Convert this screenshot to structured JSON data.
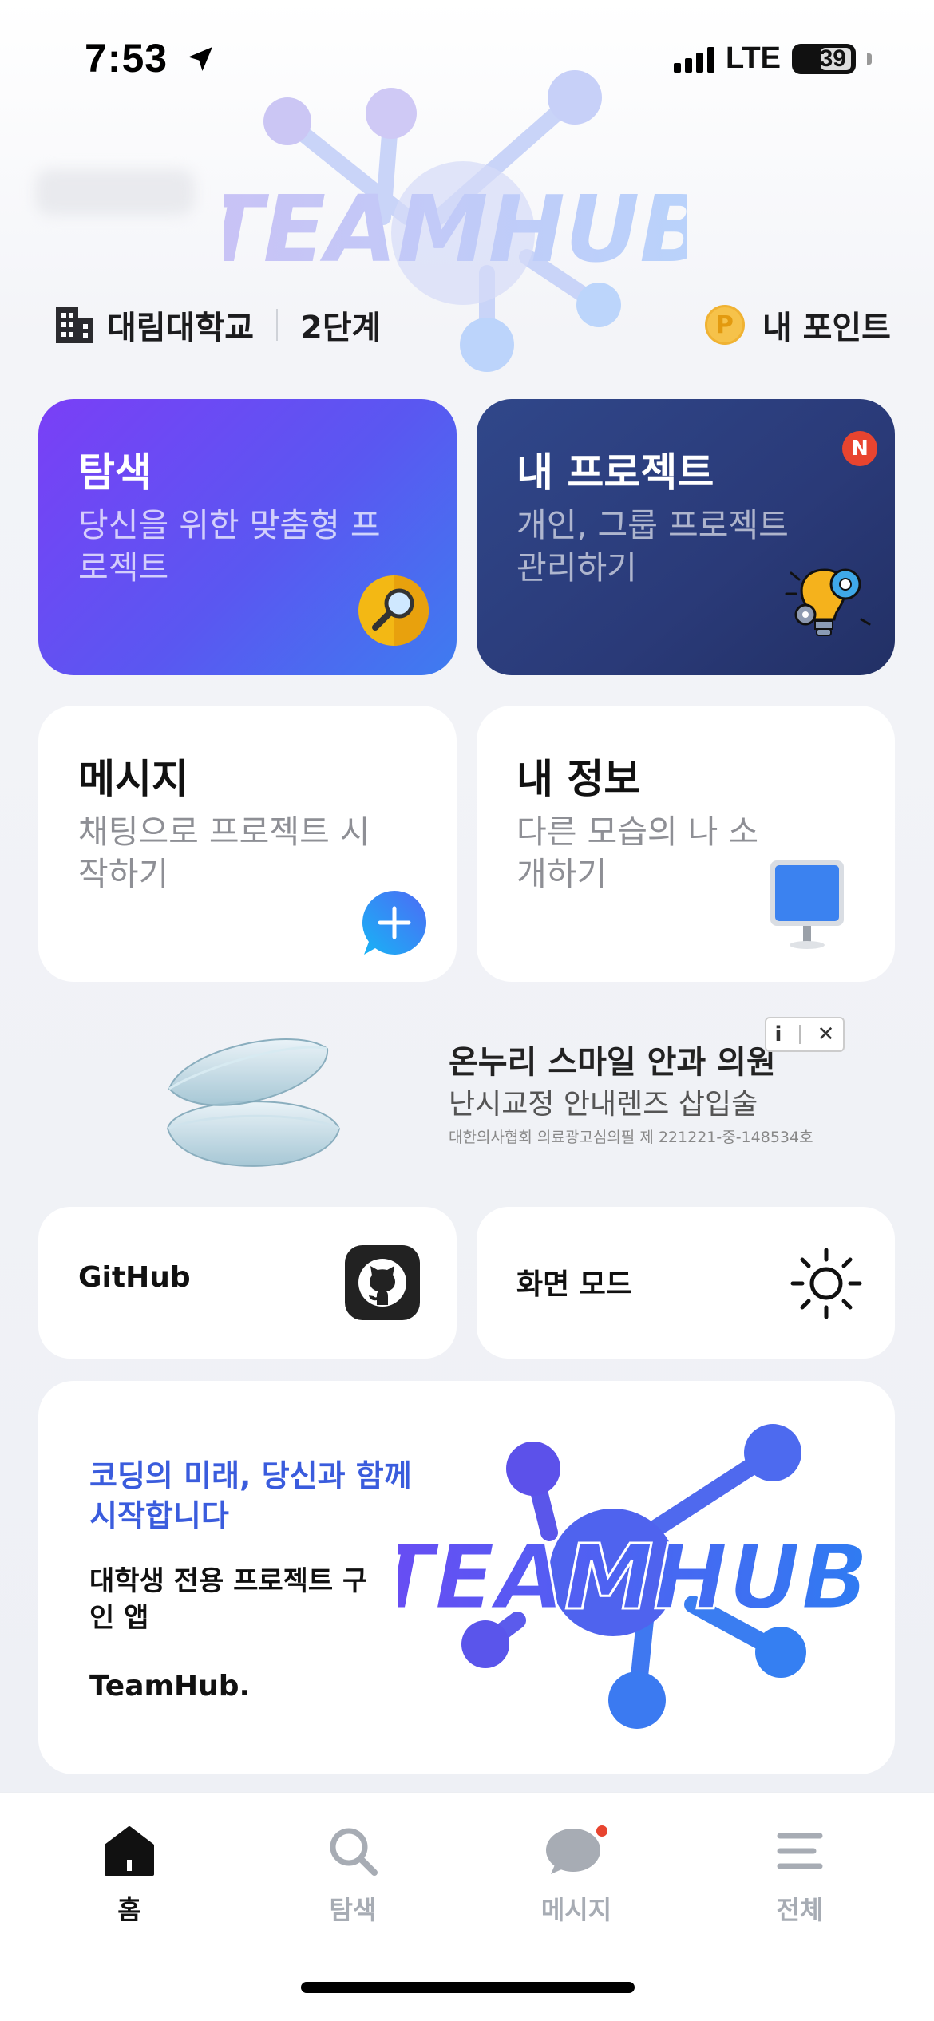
{
  "status_bar": {
    "time": "7:53",
    "network": "LTE",
    "battery": "39"
  },
  "header": {
    "logo_text": "TEAMHUB",
    "school": "대림대학교",
    "level": "2단계",
    "points_label": "내 포인트",
    "coin_letter": "P"
  },
  "cards": {
    "explore": {
      "title": "탐색",
      "subtitle": "당신을 위한 맞춤형 프로젝트"
    },
    "my_project": {
      "title": "내 프로젝트",
      "subtitle": "개인, 그룹 프로젝트 관리하기",
      "badge": "N"
    },
    "message": {
      "title": "메시지",
      "subtitle": "채팅으로 프로젝트 시작하기"
    },
    "my_info": {
      "title": "내 정보",
      "subtitle": "다른 모습의 나 소개하기"
    }
  },
  "ad": {
    "title": "온누리 스마일 안과 의원",
    "subtitle": "난시교정 안내렌즈 삽입술",
    "note": "대한의사협회 의료광고심의필 제 221221-중-148534호",
    "info_icon": "i",
    "close_icon": "✕"
  },
  "tiles": {
    "github": "GitHub",
    "screen_mode": "화면 모드"
  },
  "banner": {
    "headline": "코딩의 미래, 당신과 함께 시작합니다",
    "body": "대학생 전용 프로젝트 구인 앱",
    "brand": "TeamHub.",
    "logo_text": "TEAMHUB"
  },
  "tabbar": {
    "home": "홈",
    "explore": "탐색",
    "message": "메시지",
    "all": "전체"
  },
  "colors": {
    "accent": "#3a5cdd",
    "explore_card": "#6a4bf3",
    "project_card": "#2a3a78",
    "badge": "#e8442f"
  }
}
